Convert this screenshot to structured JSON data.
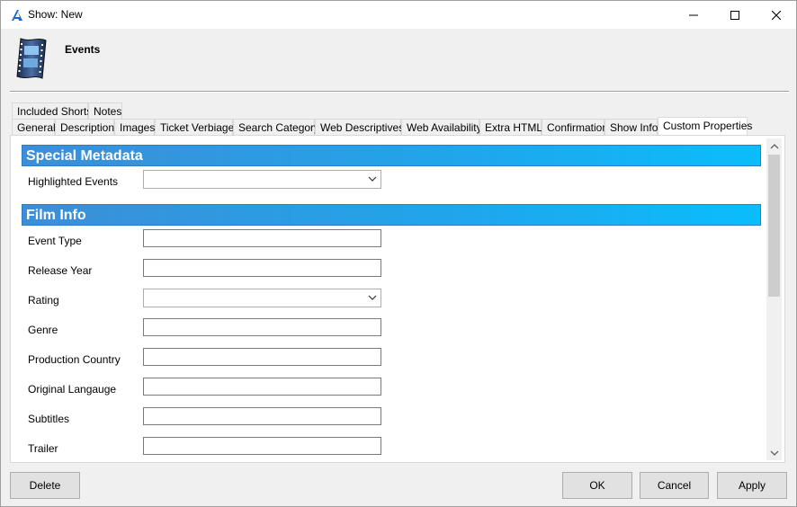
{
  "window": {
    "title": "Show: New",
    "header_title": "Events"
  },
  "tabs_row1": [
    {
      "label": "Included Shorts"
    },
    {
      "label": "Notes"
    }
  ],
  "tabs_row2": [
    {
      "label": "General"
    },
    {
      "label": "Description"
    },
    {
      "label": "Images"
    },
    {
      "label": "Ticket Verbiage"
    },
    {
      "label": "Search Category"
    },
    {
      "label": "Web Descriptives"
    },
    {
      "label": "Web Availability"
    },
    {
      "label": "Extra HTML"
    },
    {
      "label": "Confirmation"
    },
    {
      "label": "Show Info"
    },
    {
      "label": "Custom Properties",
      "active": true
    }
  ],
  "sections": {
    "special_metadata": {
      "title": "Special Metadata",
      "fields": {
        "highlighted_events": {
          "label": "Highlighted Events",
          "value": ""
        }
      }
    },
    "film_info": {
      "title": "Film Info",
      "fields": {
        "event_type": {
          "label": "Event Type",
          "value": ""
        },
        "release_year": {
          "label": "Release Year",
          "value": ""
        },
        "rating": {
          "label": "Rating",
          "value": ""
        },
        "genre": {
          "label": "Genre",
          "value": ""
        },
        "production_country": {
          "label": "Production Country",
          "value": ""
        },
        "original_language": {
          "label": "Original Langauge",
          "value": ""
        },
        "subtitles": {
          "label": "Subtitles",
          "value": ""
        },
        "trailer": {
          "label": "Trailer",
          "value": ""
        }
      }
    }
  },
  "buttons": {
    "delete": "Delete",
    "ok": "OK",
    "cancel": "Cancel",
    "apply": "Apply"
  },
  "icons": {
    "app": "app-logo-icon",
    "header": "film-strip-icon",
    "minimize": "minimize-icon",
    "maximize": "maximize-icon",
    "close": "close-icon"
  },
  "colors": {
    "section_gradient_start": "#3d8ed6",
    "section_gradient_end": "#0bbdfb"
  }
}
